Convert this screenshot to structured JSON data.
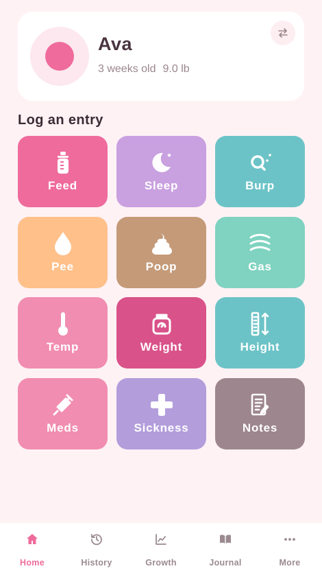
{
  "profile": {
    "name": "Ava",
    "age": "3 weeks old",
    "weight": "9.0 lb",
    "avatar_color": "#ef6b9c"
  },
  "section_title": "Log an entry",
  "entries": [
    {
      "label": "Feed",
      "icon": "bottle-icon",
      "color": "#ef6b9c"
    },
    {
      "label": "Sleep",
      "icon": "moon-icon",
      "color": "#c9a0e0"
    },
    {
      "label": "Burp",
      "icon": "burp-icon",
      "color": "#6cc3c7"
    },
    {
      "label": "Pee",
      "icon": "droplet-icon",
      "color": "#ffc08a"
    },
    {
      "label": "Poop",
      "icon": "poop-icon",
      "color": "#c49a78"
    },
    {
      "label": "Gas",
      "icon": "wind-icon",
      "color": "#7fd3c0"
    },
    {
      "label": "Temp",
      "icon": "thermometer-icon",
      "color": "#f18db0"
    },
    {
      "label": "Weight",
      "icon": "scale-icon",
      "color": "#d9528a"
    },
    {
      "label": "Height",
      "icon": "ruler-icon",
      "color": "#6cc3c7"
    },
    {
      "label": "Meds",
      "icon": "syringe-icon",
      "color": "#f18db0"
    },
    {
      "label": "Sickness",
      "icon": "plus-icon",
      "color": "#b39ddb"
    },
    {
      "label": "Notes",
      "icon": "notes-icon",
      "color": "#9d868d"
    }
  ],
  "nav": [
    {
      "label": "Home",
      "icon": "home-icon",
      "active": true
    },
    {
      "label": "History",
      "icon": "history-icon",
      "active": false
    },
    {
      "label": "Growth",
      "icon": "chart-icon",
      "active": false
    },
    {
      "label": "Journal",
      "icon": "book-icon",
      "active": false
    },
    {
      "label": "More",
      "icon": "more-icon",
      "active": false
    }
  ]
}
